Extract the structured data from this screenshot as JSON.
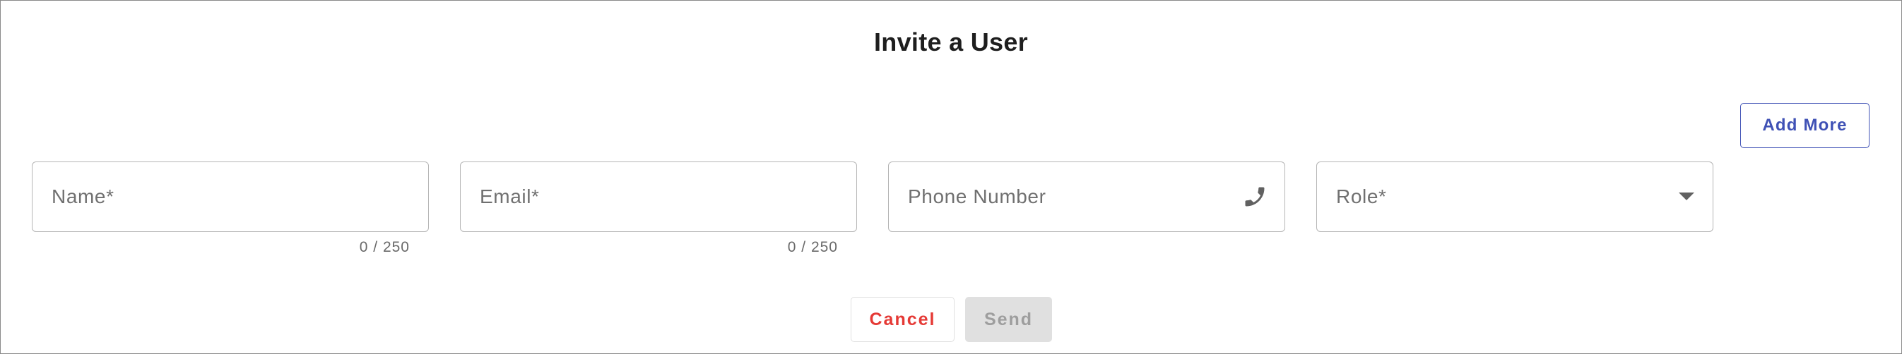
{
  "dialog": {
    "title": "Invite a User",
    "add_more_label": "Add More",
    "fields": {
      "name": {
        "placeholder": "Name*",
        "counter": "0 / 250"
      },
      "email": {
        "placeholder": "Email*",
        "counter": "0 / 250"
      },
      "phone": {
        "placeholder": "Phone Number",
        "icon": "phone-icon"
      },
      "role": {
        "placeholder": "Role*",
        "icon": "dropdown-arrow-icon"
      }
    },
    "actions": {
      "cancel_label": "Cancel",
      "send_label": "Send"
    }
  },
  "colors": {
    "accent": "#3f51b5",
    "cancel": "#e53935",
    "disabled_bg": "#e0e0e0",
    "disabled_text": "#9e9e9e"
  }
}
